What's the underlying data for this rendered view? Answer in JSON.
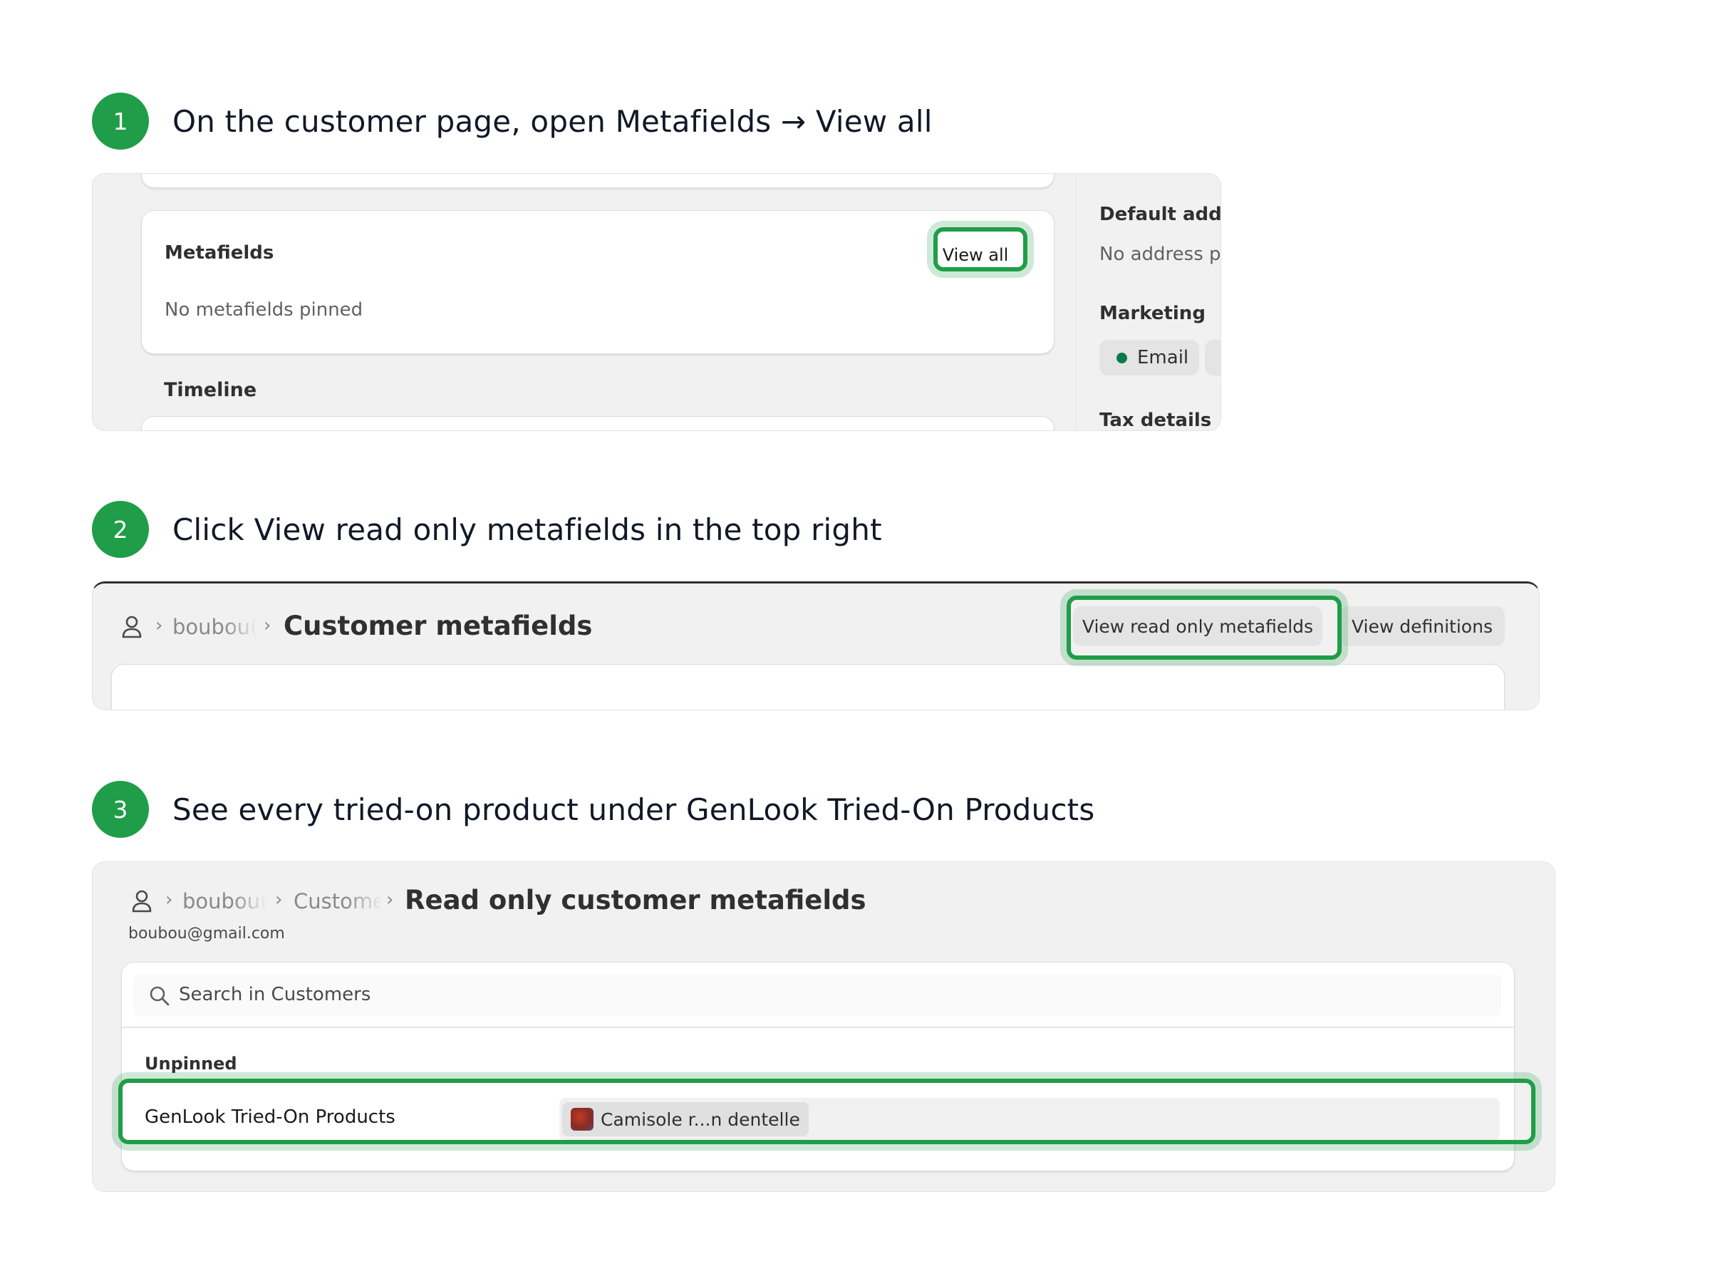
{
  "steps": [
    {
      "number": "1",
      "text": "On the customer page, open Metafields → View all"
    },
    {
      "number": "2",
      "text": "Click View read only metafields in the top right"
    },
    {
      "number": "3",
      "text": "See every tried-on product under GenLook Tried-On Products"
    }
  ],
  "panel1": {
    "metafields_title": "Metafields",
    "view_all": "View all",
    "no_pinned": "No metafields pinned",
    "timeline": "Timeline",
    "default_address": "Default addre",
    "no_address": "No address p",
    "marketing": "Marketing",
    "email": "Email",
    "tax_details": "Tax details"
  },
  "panel2": {
    "crumb": "boubou(",
    "title": "Customer metafields",
    "view_read_only": "View read only metafields",
    "view_definitions": "View definitions"
  },
  "panel3": {
    "crumb1": "boubou(",
    "crumb2": "Custome",
    "title": "Read only customer metafields",
    "email": "boubou@gmail.com",
    "search_placeholder": "Search in Customers",
    "section": "Unpinned",
    "row_label": "GenLook Tried-On Products",
    "product_chip": "Camisole r...n dentelle"
  },
  "colors": {
    "accent_green": "#1f9d48",
    "dot_green": "#0b7a4b"
  }
}
